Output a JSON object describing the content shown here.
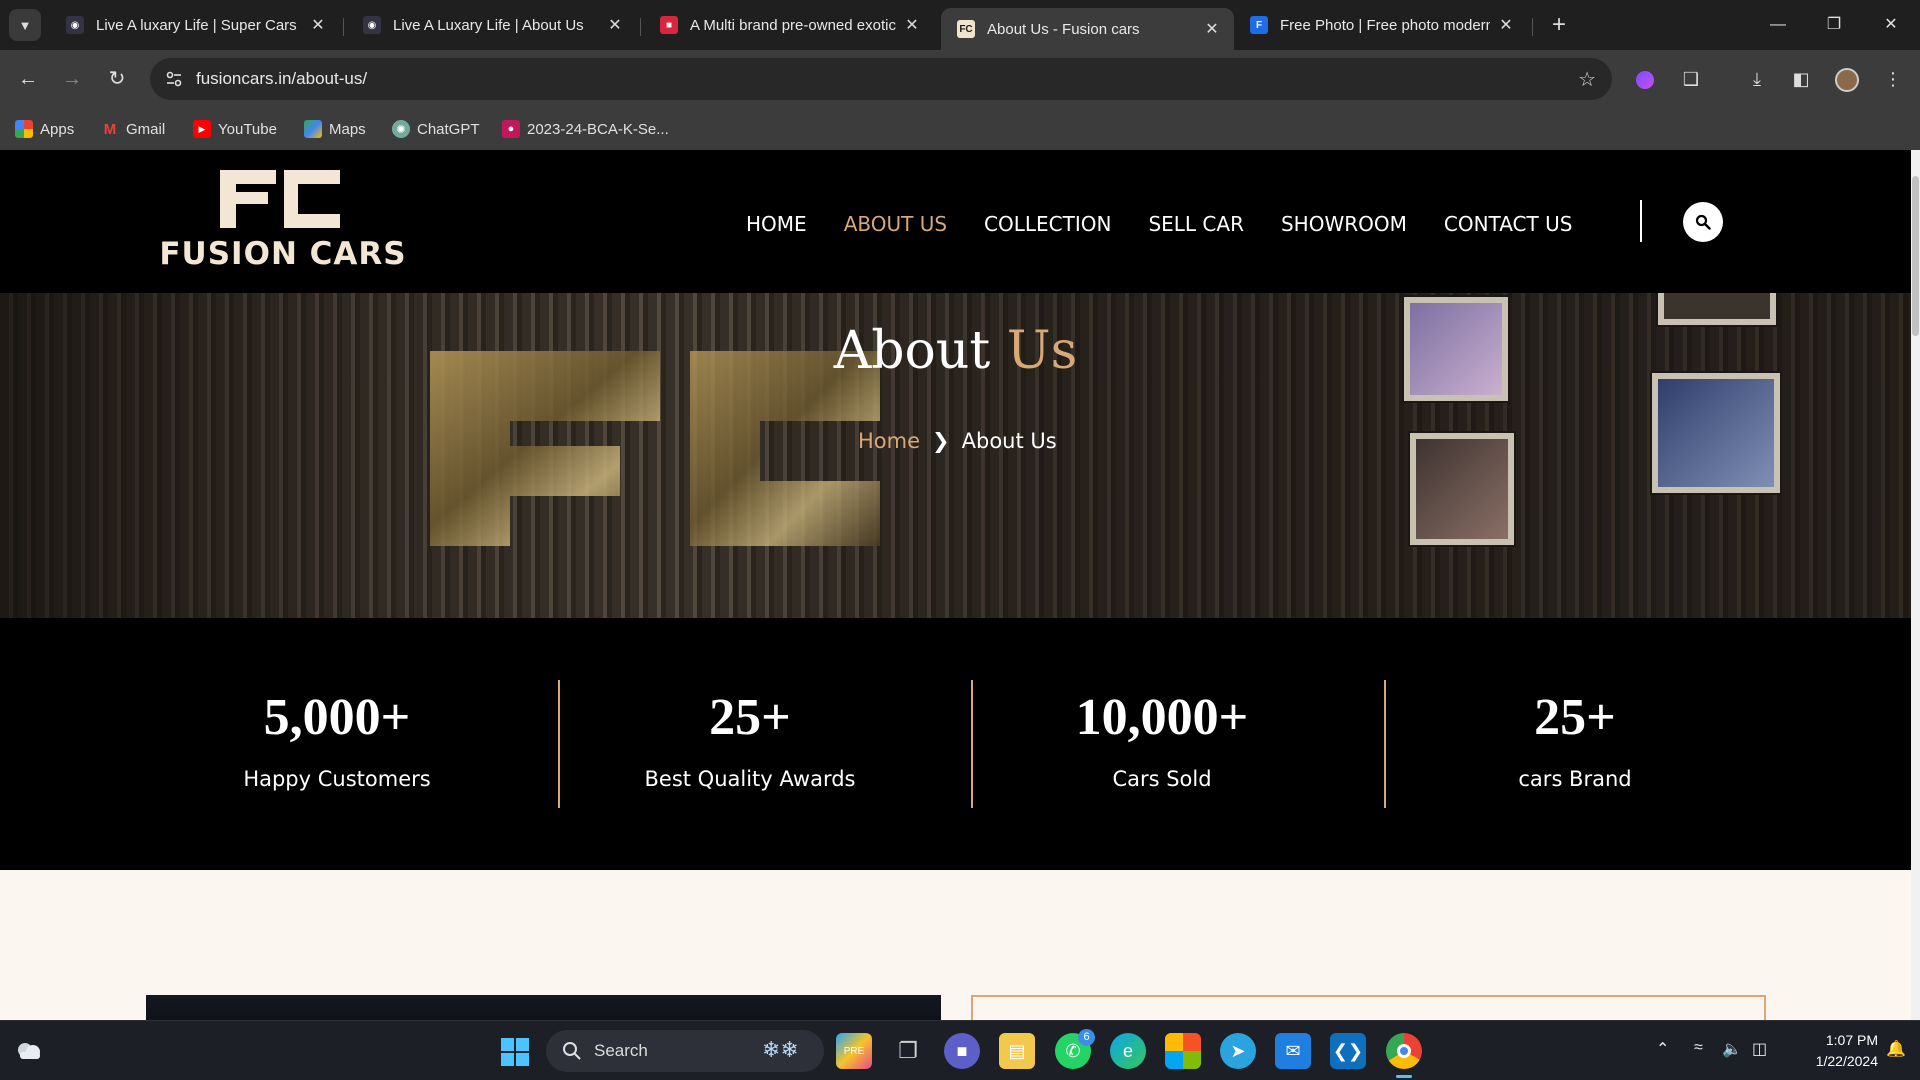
{
  "browser": {
    "tabs": [
      {
        "title": "Live A luxary Life | Super Cars",
        "favicon": "globe-icon",
        "active": false
      },
      {
        "title": "Live A Luxary Life | About Us",
        "favicon": "globe-icon",
        "active": false
      },
      {
        "title": "A Multi brand pre-owned exotic",
        "favicon": "car-icon",
        "active": false
      },
      {
        "title": "About Us - Fusion cars",
        "favicon": "fc-icon",
        "active": true
      },
      {
        "title": "Free Photo | Free photo modern",
        "favicon": "freepik-icon",
        "active": false
      }
    ],
    "url": "fusioncars.in/about-us/",
    "bookmarks": [
      {
        "label": "Apps",
        "icon": "apps-grid-icon"
      },
      {
        "label": "Gmail",
        "icon": "gmail-icon"
      },
      {
        "label": "YouTube",
        "icon": "youtube-icon"
      },
      {
        "label": "Maps",
        "icon": "maps-icon"
      },
      {
        "label": "ChatGPT",
        "icon": "chatgpt-icon"
      },
      {
        "label": "2023-24-BCA-K-Se...",
        "icon": "classroom-icon"
      }
    ]
  },
  "site": {
    "logo_text": "FUSION CARS",
    "nav": [
      {
        "label": "HOME",
        "active": false
      },
      {
        "label": "ABOUT US",
        "active": true
      },
      {
        "label": "COLLECTION",
        "active": false
      },
      {
        "label": "SELL CAR",
        "active": false
      },
      {
        "label": "SHOWROOM",
        "active": false
      },
      {
        "label": "CONTACT US",
        "active": false
      }
    ],
    "hero": {
      "title_main": "About",
      "title_accent": "Us",
      "breadcrumb_home": "Home",
      "breadcrumb_current": "About Us"
    },
    "stats": [
      {
        "value": "5,000+",
        "label": "Happy Customers"
      },
      {
        "value": "25+",
        "label": "Best Quality Awards"
      },
      {
        "value": "10,000+",
        "label": "Cars Sold"
      },
      {
        "value": "25+",
        "label": "cars Brand"
      }
    ],
    "accent_color": "#d9a877"
  },
  "taskbar": {
    "search_label": "Search",
    "whatsapp_badge": "6",
    "time": "1:07 PM",
    "date": "1/22/2024"
  }
}
